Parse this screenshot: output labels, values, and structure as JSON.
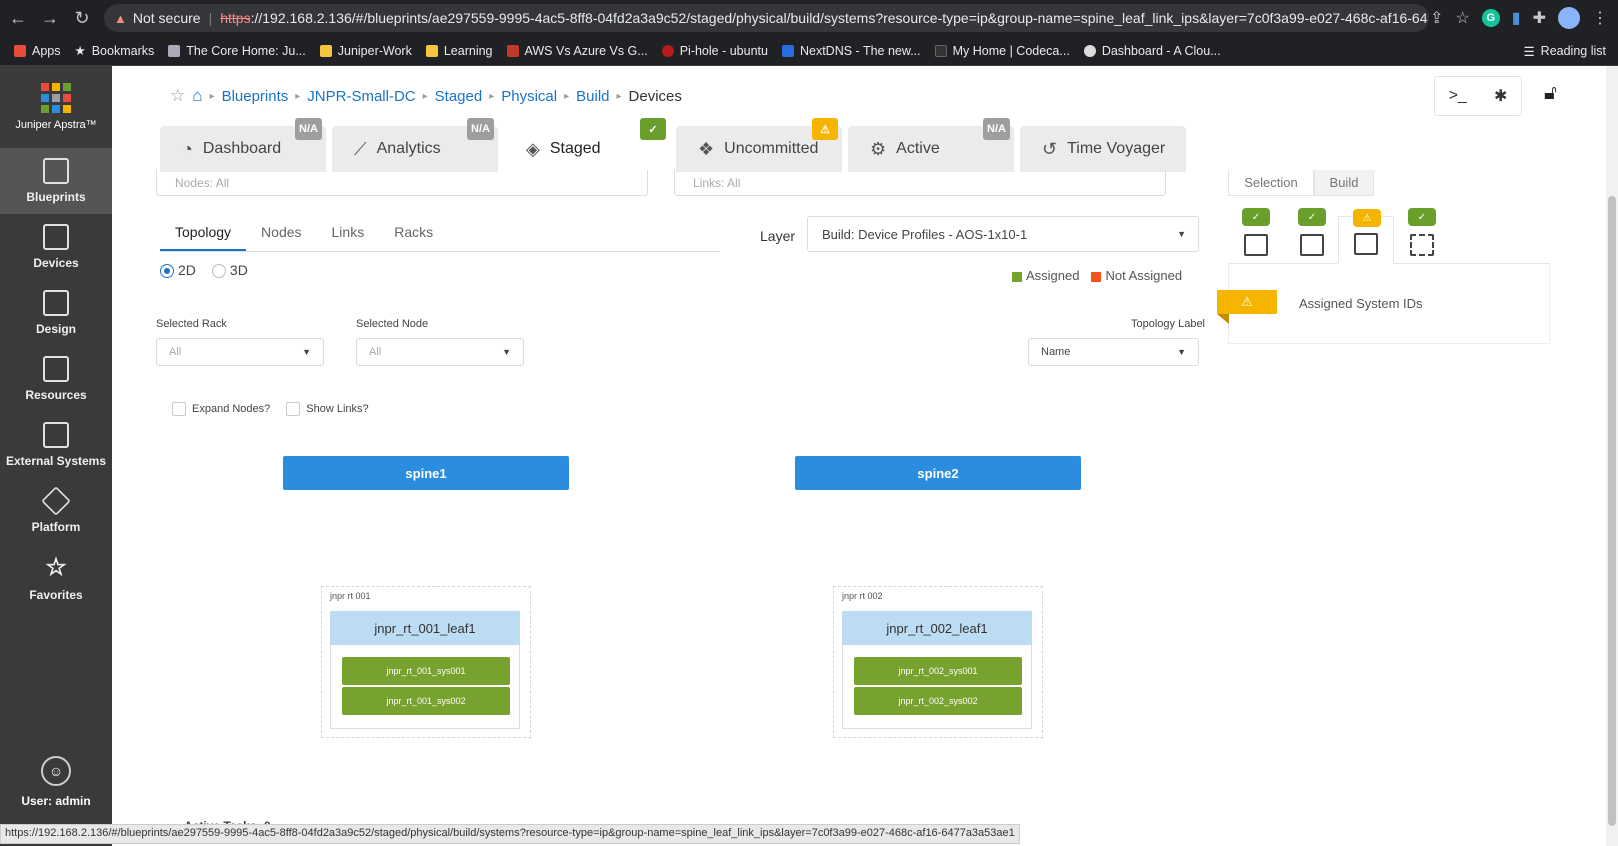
{
  "browser": {
    "not_secure": "Not secure",
    "url_scheme": "https",
    "url_rest": "://192.168.2.136/#/blueprints/ae297559-9995-4ac5-8ff8-04fd2a3a9c52/staged/physical/build/systems?resource-type=ip&group-name=spine_leaf_link_ips&layer=7c0f3a99-e027-468c-af16-6477...",
    "extension_letter": "G"
  },
  "bookmarks": {
    "items": [
      "Apps",
      "Bookmarks",
      "The Core Home: Ju...",
      "Juniper-Work",
      "Learning",
      "AWS Vs Azure Vs G...",
      "Pi-hole - ubuntu",
      "NextDNS - The new...",
      "My Home | Codeca...",
      "Dashboard - A Clou..."
    ],
    "reading_list": "Reading list"
  },
  "leftnav": {
    "brand": "Juniper Apstra™",
    "items": [
      "Blueprints",
      "Devices",
      "Design",
      "Resources",
      "External Systems",
      "Platform",
      "Favorites"
    ],
    "user": "User: admin",
    "colors": [
      "#e94b3c",
      "#f5b400",
      "#6a9f2c",
      "#2b8de0",
      "#9e9e9e",
      "#e94b3c",
      "#6a9f2c",
      "#2b8de0",
      "#f5b400"
    ]
  },
  "breadcrumb": [
    "Blueprints",
    "JNPR-Small-DC",
    "Staged",
    "Physical",
    "Build"
  ],
  "breadcrumb_current": "Devices",
  "tabs": [
    {
      "label": "Dashboard",
      "badge": "N/A",
      "badge_type": "na",
      "icon": "gauge-icon"
    },
    {
      "label": "Analytics",
      "badge": "N/A",
      "badge_type": "na",
      "icon": "chart-icon"
    },
    {
      "label": "Staged",
      "badge": "✓",
      "badge_type": "ok",
      "icon": "cube-icon"
    },
    {
      "label": "Uncommitted",
      "badge": "⚠",
      "badge_type": "warn",
      "icon": "cubes-icon"
    },
    {
      "label": "Active",
      "badge": "N/A",
      "badge_type": "na",
      "icon": "active-icon"
    },
    {
      "label": "Time Voyager",
      "badge": "",
      "badge_type": "",
      "icon": "history-icon"
    }
  ],
  "filters": {
    "nodes": "Nodes: All",
    "links": "Links: All"
  },
  "inner_tabs": [
    "Topology",
    "Nodes",
    "Links",
    "Racks"
  ],
  "view_modes": [
    "2D",
    "3D"
  ],
  "layer": {
    "label": "Layer",
    "value": "Build: Device Profiles - AOS-1x10-1"
  },
  "legend": {
    "assigned": "Assigned",
    "not_assigned": "Not Assigned",
    "assigned_color": "#78a22f",
    "not_assigned_color": "#f4511e"
  },
  "selected_rack": {
    "label": "Selected Rack",
    "value": "All"
  },
  "selected_node": {
    "label": "Selected Node",
    "value": "All"
  },
  "topology_label": {
    "label": "Topology Label",
    "value": "Name"
  },
  "checks": {
    "expand_nodes": "Expand Nodes?",
    "show_links": "Show Links?"
  },
  "topology": {
    "spines": [
      "spine1",
      "spine2"
    ],
    "racks": [
      {
        "name": "jnpr rt 001",
        "leaf": "jnpr_rt_001_leaf1",
        "systems": [
          "jnpr_rt_001_sys001",
          "jnpr_rt_001_sys002"
        ]
      },
      {
        "name": "jnpr rt 002",
        "leaf": "jnpr_rt_002_leaf1",
        "systems": [
          "jnpr_rt_002_sys001",
          "jnpr_rt_002_sys002"
        ]
      }
    ]
  },
  "right_panel": {
    "tabs": [
      "Selection",
      "Build"
    ],
    "icon_badges": [
      "✓",
      "✓",
      "⚠",
      "✓"
    ],
    "warn_flag": "⚠",
    "message": "Assigned System IDs"
  },
  "status_bar": {
    "url": "https://192.168.2.136/#/blueprints/ae297559-9995-4ac5-8ff8-04fd2a3a9c52/staged/physical/build/systems?resource-type=ip&group-name=spine_leaf_link_ips&layer=7c0f3a99-e027-468c-af16-6477a3a53ae1",
    "active_tasks": "Active Tasks: 0"
  }
}
